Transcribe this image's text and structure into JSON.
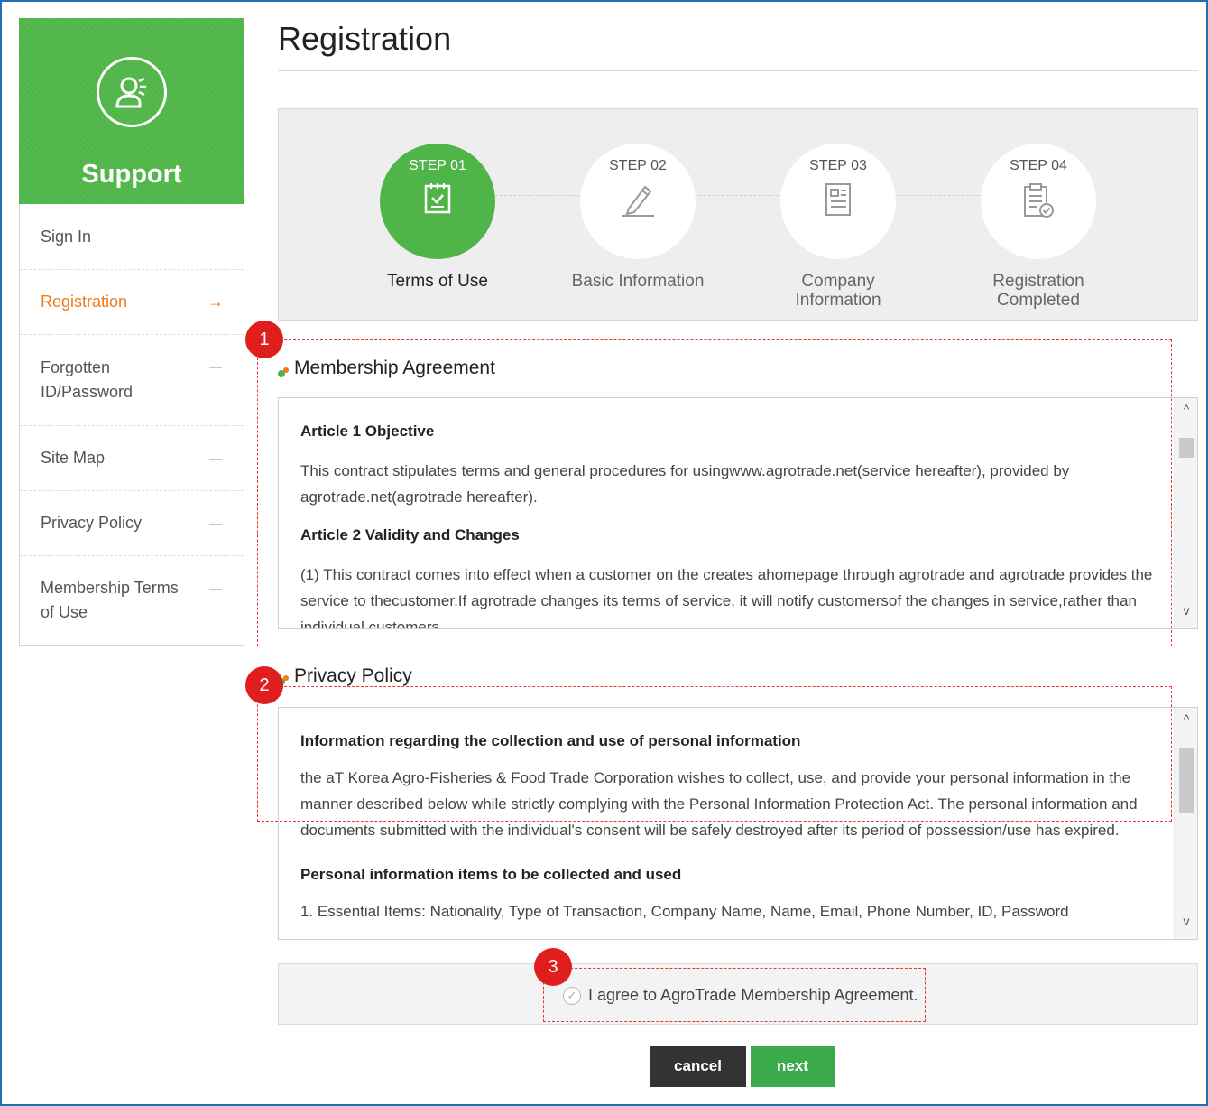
{
  "sidebar": {
    "title": "Support",
    "items": [
      {
        "label": "Sign In"
      },
      {
        "label": "Registration"
      },
      {
        "label": "Forgotten ID/Password"
      },
      {
        "label": "Site Map"
      },
      {
        "label": "Privacy Policy"
      },
      {
        "label": "Membership Terms of Use"
      }
    ],
    "active_arrow": "→"
  },
  "page": {
    "title": "Registration"
  },
  "steps": [
    {
      "no": "STEP 01",
      "label": "Terms of Use"
    },
    {
      "no": "STEP 02",
      "label": "Basic Information"
    },
    {
      "no": "STEP 03",
      "label": "Company Information"
    },
    {
      "no": "STEP 04",
      "label": "Registration Completed"
    }
  ],
  "membership": {
    "title": "Membership Agreement",
    "article1_title": "Article 1 Objective",
    "article1_text": "This contract stipulates terms and general procedures for usingwww.agrotrade.net(service hereafter), provided by agrotrade.net(agrotrade hereafter).",
    "article2_title": "Article 2 Validity and Changes",
    "article2_text": "(1) This contract comes into effect when a customer on the creates ahomepage through agrotrade and agrotrade provides the service to thecustomer.If agrotrade changes its terms of service, it will notify customersof the changes in service,rather than individual customers."
  },
  "privacy": {
    "title": "Privacy Policy",
    "heading": "Information regarding the collection and use of personal information",
    "text": "the aT Korea Agro-Fisheries & Food Trade Corporation wishes to collect, use, and provide your personal information in the manner described below while strictly complying with the Personal Information Protection Act. The personal information and documents submitted with the individual's consent will be safely destroyed after its period of possession/use has expired.",
    "subheading": "Personal information items to be collected and used",
    "item1": "1. Essential Items: Nationality, Type of Transaction, Company Name, Name, Email, Phone Number, ID, Password"
  },
  "agree": {
    "label": "I agree to AgroTrade Membership Agreement."
  },
  "buttons": {
    "cancel": "cancel",
    "next": "next"
  },
  "annotations": [
    "1",
    "2",
    "3"
  ],
  "colors": {
    "green": "#4fb548",
    "orange": "#f07a1c",
    "badge_red": "#e11e1e",
    "cancel": "#333333",
    "next": "#3aaa4a"
  }
}
